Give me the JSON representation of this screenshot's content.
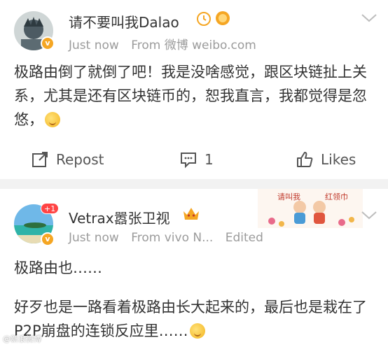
{
  "posts": [
    {
      "username": "请不要叫我Dalao",
      "time": "Just now",
      "source": "From 微博 weibo.com",
      "body": "极路由倒了就倒了吧！我是没啥感觉，跟区块链扯上关系，尤其是还有区块链币的，恕我直言，我都觉得是忽悠，",
      "actions": {
        "repost": "Repost",
        "comment_count": "1",
        "likes": "Likes"
      }
    },
    {
      "username": "Vetrax嚣张卫视",
      "time": "Just now",
      "source": "From vivo N...",
      "edited": "Edited",
      "notif_count": "+1",
      "body_line1": "极路由也……",
      "body_line2": "好歹也是一路看着极路由长大起来的，最后也是栽在了P2P崩盘的连锁反应里……",
      "banner_text_left": "请叫我",
      "banner_text_right": "红领巾"
    }
  ],
  "badge": "v",
  "watermark": "@新浪微博",
  "colors": {
    "accent_orange": "#f5a623",
    "meta_gray": "#9b9b9b",
    "divider": "#f2f2f2"
  }
}
